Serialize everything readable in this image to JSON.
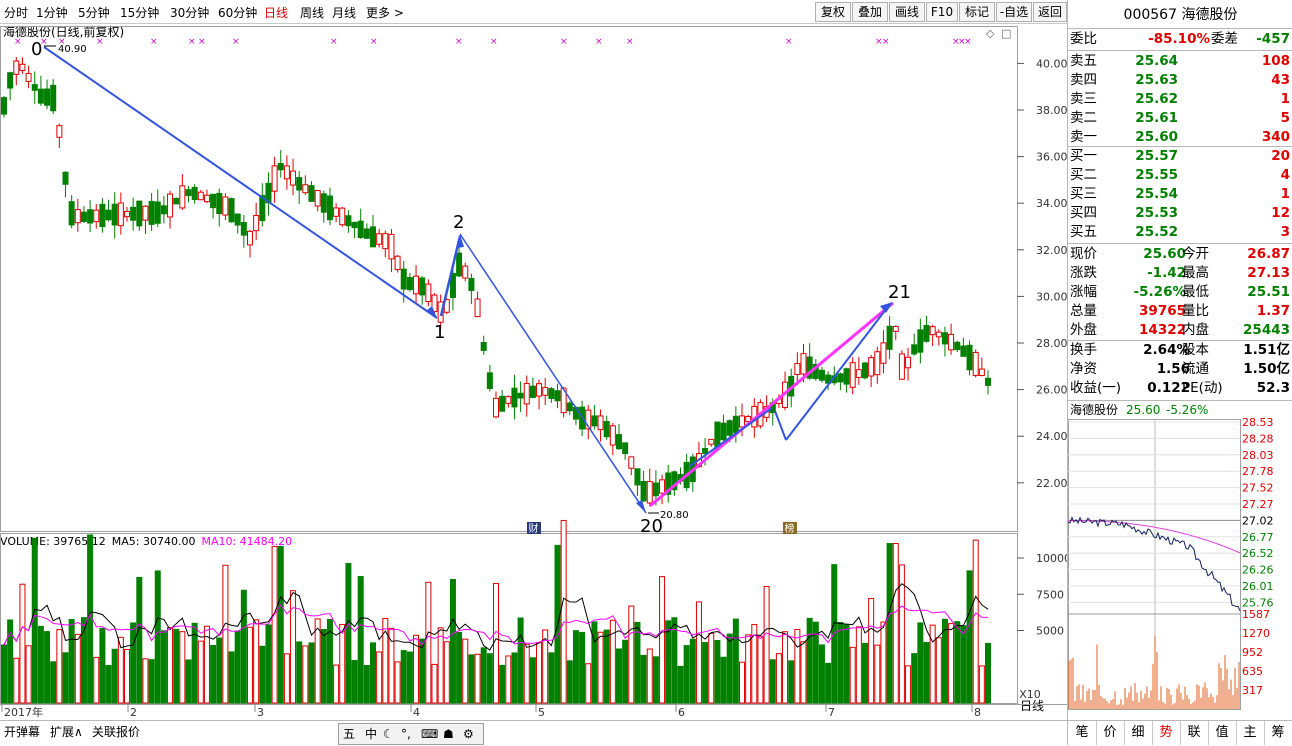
{
  "toolbar": {
    "periods": [
      "分时",
      "1分钟",
      "5分钟",
      "15分钟",
      "30分钟",
      "60分钟",
      "日线",
      "周线",
      "月线",
      "更多 >"
    ],
    "active_period": "日线",
    "buttons": [
      "复权",
      "叠加",
      "画线",
      "F10",
      "标记",
      "-自选",
      "返回"
    ]
  },
  "chart": {
    "title": "海德股份(日线,前复权)",
    "high_label": "40.90",
    "low_label": "20.80",
    "y_ticks": [
      "40.00",
      "38.00",
      "36.00",
      "34.00",
      "32.00",
      "30.00",
      "28.00",
      "26.00",
      "24.00",
      "22.00"
    ],
    "wave_labels": [
      "0",
      "1",
      "2",
      "20",
      "21"
    ],
    "event_markers": [
      "财",
      "榜"
    ],
    "x_months": [
      "2017年",
      "2",
      "3",
      "4",
      "5",
      "6",
      "7",
      "8"
    ],
    "volume_legend": {
      "volume": "VOLUME: 39765.12",
      "ma5": "MA5: 30740.00",
      "ma10": "MA10: 41484.20"
    },
    "vol_ticks": [
      "10000",
      "7500",
      "5000"
    ],
    "vol_unit": "X10",
    "period_label": "日线",
    "colors": {
      "up": "#e00000",
      "down": "#008000",
      "line1": "#3355dd",
      "line2": "#ff33ff"
    }
  },
  "quote": {
    "code_name": "000567 海德股份",
    "weibi_label": "委比",
    "weibi": "-85.10%",
    "weicha_label": "委差",
    "weicha": "-457",
    "asks": [
      {
        "label": "卖五",
        "price": "25.64",
        "vol": "108"
      },
      {
        "label": "卖四",
        "price": "25.63",
        "vol": "43"
      },
      {
        "label": "卖三",
        "price": "25.62",
        "vol": "1"
      },
      {
        "label": "卖二",
        "price": "25.61",
        "vol": "5"
      },
      {
        "label": "卖一",
        "price": "25.60",
        "vol": "340"
      }
    ],
    "bids": [
      {
        "label": "买一",
        "price": "25.57",
        "vol": "20"
      },
      {
        "label": "买二",
        "price": "25.55",
        "vol": "4"
      },
      {
        "label": "买三",
        "price": "25.54",
        "vol": "1"
      },
      {
        "label": "买四",
        "price": "25.53",
        "vol": "12"
      },
      {
        "label": "买五",
        "price": "25.52",
        "vol": "3"
      }
    ],
    "stats": [
      {
        "l1": "现价",
        "v1": "25.60",
        "l2": "今开",
        "v2": "26.87"
      },
      {
        "l1": "涨跌",
        "v1": "-1.42",
        "l2": "最高",
        "v2": "27.13"
      },
      {
        "l1": "涨幅",
        "v1": "-5.26%",
        "l2": "最低",
        "v2": "25.51"
      },
      {
        "l1": "总量",
        "v1": "39765",
        "l2": "量比",
        "v2": "1.37"
      },
      {
        "l1": "外盘",
        "v1": "14322",
        "l2": "内盘",
        "v2": "25443"
      }
    ],
    "stats2": [
      {
        "l1": "换手",
        "v1": "2.64%",
        "l2": "股本",
        "v2": "1.51亿"
      },
      {
        "l1": "净资",
        "v1": "1.56",
        "l2": "流通",
        "v2": "1.50亿"
      },
      {
        "l1": "收益(一)",
        "v1": "0.122",
        "l2": "PE(动)",
        "v2": "52.3"
      }
    ]
  },
  "mini": {
    "title": "海德股份",
    "price": "25.60",
    "change": "-5.26%",
    "price_ticks": [
      "28.53",
      "28.28",
      "28.03",
      "27.78",
      "27.52",
      "27.27",
      "27.02",
      "26.77",
      "26.52",
      "26.26",
      "26.01",
      "25.76"
    ],
    "vol_ticks": [
      "1587",
      "1270",
      "952",
      "635",
      "317"
    ]
  },
  "bottom": {
    "buttons": [
      "开弹幕",
      "扩展∧",
      "关联报价"
    ]
  },
  "right_tabs": [
    "笔",
    "价",
    "细",
    "势",
    "联",
    "值",
    "主",
    "筹"
  ],
  "active_right_tab": "势"
}
